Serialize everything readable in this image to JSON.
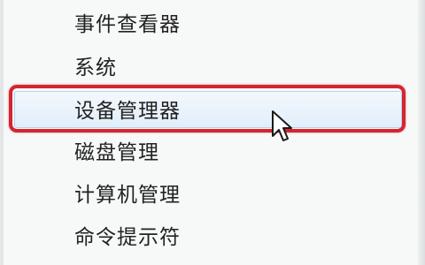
{
  "context_menu": {
    "items": [
      {
        "label": "事件查看器"
      },
      {
        "label": "系统"
      },
      {
        "label": "设备管理器",
        "state": "hovered",
        "highlighted": true
      },
      {
        "label": "磁盘管理"
      },
      {
        "label": "计算机管理"
      },
      {
        "label": "命令提示符"
      }
    ]
  },
  "annotation": {
    "highlight_color": "#d62431",
    "target": "设备管理器"
  },
  "cursor": {
    "icon": "arrow-pointer-icon"
  }
}
